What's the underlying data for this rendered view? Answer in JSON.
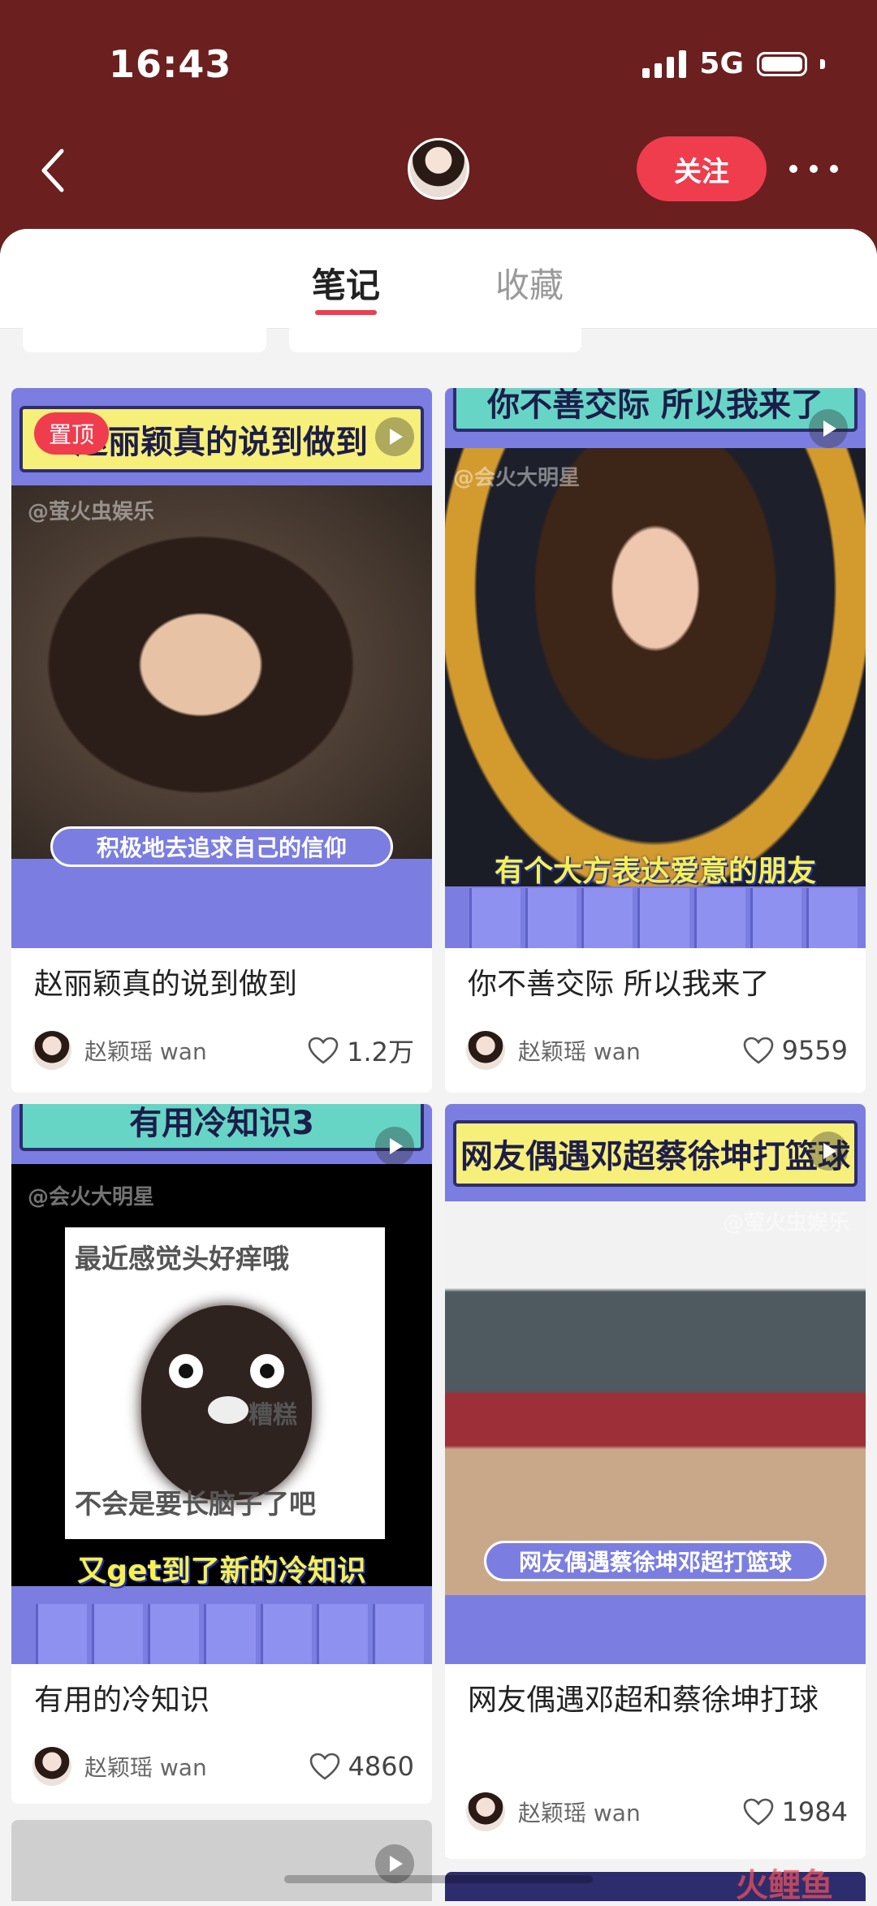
{
  "status_bar": {
    "time": "16:43",
    "network": "5G"
  },
  "header": {
    "follow_label": "关注"
  },
  "tabs": [
    {
      "label": "笔记",
      "active": true
    },
    {
      "label": "收藏",
      "active": false
    }
  ],
  "notes": [
    {
      "pinned_label": "置顶",
      "banner": "赵丽颖真的说到做到",
      "watermark": "@萤火虫娱乐",
      "overlay_text": "积极地去追求自己的信仰",
      "title": "赵丽颖真的说到做到",
      "author": "赵颖瑶 wan",
      "likes": "1.2万"
    },
    {
      "banner": "你不善交际 所以我来了",
      "watermark": "@会火大明星",
      "overlay_text": "有个大方表达爱意的朋友",
      "title": "你不善交际 所以我来了",
      "author": "赵颖瑶 wan",
      "likes": "9559"
    },
    {
      "banner": "有用冷知识3",
      "watermark": "@会火大明星",
      "meme_top": "最近感觉头好痒哦",
      "meme_mid": "糟糕",
      "meme_bottom": "不会是要长脑子了吧",
      "overlay_text": "又get到了新的冷知识",
      "title": "有用的冷知识",
      "author": "赵颖瑶 wan",
      "likes": "4860"
    },
    {
      "banner": "网友偶遇邓超蔡徐坤打篮球",
      "watermark": "@萤火虫娱乐",
      "overlay_text": "网友偶遇蔡徐坤邓超打篮球",
      "title": "网友偶遇邓超和蔡徐坤打球",
      "author": "赵颖瑶 wan",
      "likes": "1984"
    }
  ],
  "colors": {
    "header_bg": "#6b1f1f",
    "accent": "#ef3d4e",
    "card_purple": "#7b7ee0"
  },
  "watermark_logo": "火鲤鱼"
}
